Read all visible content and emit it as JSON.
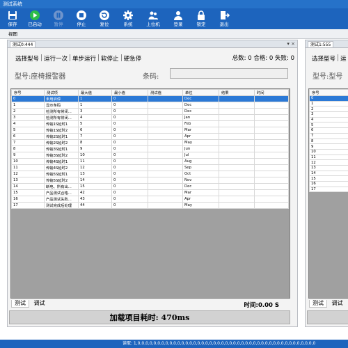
{
  "window": {
    "title": "测试系统"
  },
  "toolbar": [
    {
      "label": "保存",
      "icon": "save-icon",
      "enabled": true
    },
    {
      "label": "已启动",
      "icon": "play-icon",
      "enabled": true
    },
    {
      "label": "暂停",
      "icon": "pause-icon",
      "enabled": false
    },
    {
      "label": "停止",
      "icon": "stop-icon",
      "enabled": true
    },
    {
      "label": "复位",
      "icon": "reset-icon",
      "enabled": true
    },
    {
      "label": "系统",
      "icon": "gear-icon",
      "enabled": true
    },
    {
      "label": "上位机",
      "icon": "users-icon",
      "enabled": true
    },
    {
      "label": "登录",
      "icon": "login-icon",
      "enabled": true
    },
    {
      "label": "锁定",
      "icon": "lock-icon",
      "enabled": true
    },
    {
      "label": "退出",
      "icon": "exit-icon",
      "enabled": true
    }
  ],
  "viewbar": {
    "label": "视图"
  },
  "colors": {
    "toolbar": "#1d64bd",
    "selected_row": "#2b79d6",
    "play_green": "#2dbd4a"
  },
  "panel1": {
    "tab": "测试0:444",
    "tab_controls": "▾ ×",
    "menu": [
      "选择型号",
      "运行一次",
      "单步运行",
      "软停止",
      "硬急停"
    ],
    "counts": "总数: 0 合格: 0 失败: 0",
    "model": "型号:座椅报警器",
    "barcode_label": "条码:",
    "barcode_value": "",
    "table": {
      "headers": [
        "序号",
        "测试项",
        "最大值",
        "最小值",
        "测试值",
        "单位",
        "结果",
        "时间"
      ],
      "rows": [
        [
          "0",
          "未用启停",
          "1",
          "0",
          "",
          "Dec",
          "",
          ""
        ],
        [
          "1",
          "显示条码",
          "1",
          "0",
          "",
          "Dec",
          "",
          ""
        ],
        [
          "2",
          "检测所有常闭...",
          "3",
          "0",
          "",
          "Dec",
          "",
          ""
        ],
        [
          "3",
          "检测所有常闭...",
          "4",
          "0",
          "",
          "Jan",
          "",
          ""
        ],
        [
          "4",
          "传输1S延时1",
          "5",
          "0",
          "",
          "Feb",
          "",
          ""
        ],
        [
          "5",
          "传输1S延时2",
          "6",
          "0",
          "",
          "Mar",
          "",
          ""
        ],
        [
          "6",
          "传输2S延时1",
          "7",
          "0",
          "",
          "Apr",
          "",
          ""
        ],
        [
          "7",
          "传输2S延时2",
          "8",
          "0",
          "",
          "May",
          "",
          ""
        ],
        [
          "8",
          "传输3S延时1",
          "9",
          "0",
          "",
          "Jun",
          "",
          ""
        ],
        [
          "9",
          "传输3S延时2",
          "10",
          "0",
          "",
          "Jul",
          "",
          ""
        ],
        [
          "10",
          "传输4S延时1",
          "11",
          "0",
          "",
          "Aug",
          "",
          ""
        ],
        [
          "11",
          "传输4S延时2",
          "12",
          "0",
          "",
          "Sep",
          "",
          ""
        ],
        [
          "12",
          "传输5S延时1",
          "13",
          "0",
          "",
          "Oct",
          "",
          ""
        ],
        [
          "13",
          "传输5S延时2",
          "14",
          "0",
          "",
          "Nov",
          "",
          ""
        ],
        [
          "14",
          "断电、所有出...",
          "15",
          "0",
          "",
          "Dec",
          "",
          ""
        ],
        [
          "15",
          "产品测试合格...",
          "42",
          "0",
          "",
          "Mar",
          "",
          ""
        ],
        [
          "16",
          "产品测试失败...",
          "43",
          "0",
          "",
          "Apr",
          "",
          ""
        ],
        [
          "17",
          "测试完成后处理",
          "44",
          "0",
          "",
          "May",
          "",
          ""
        ]
      ]
    },
    "bottom_tabs": [
      "测试",
      "调试"
    ],
    "elapsed": "时间:0.00 S",
    "status": "加载项目耗时: 470ms"
  },
  "panel2": {
    "tab": "测试1:555",
    "menu": [
      "选择型号",
      "运"
    ],
    "model": "型号:型号",
    "table": {
      "headers": [
        "序号"
      ],
      "rows": [
        [
          "0"
        ],
        [
          "1"
        ],
        [
          "2"
        ],
        [
          "3"
        ],
        [
          "4"
        ],
        [
          "5"
        ],
        [
          "6"
        ],
        [
          "7"
        ],
        [
          "8"
        ],
        [
          "9"
        ],
        [
          "10"
        ],
        [
          "11"
        ],
        [
          "12"
        ],
        [
          "13"
        ],
        [
          "14"
        ],
        [
          "15"
        ],
        [
          "16"
        ],
        [
          "17"
        ]
      ]
    },
    "bottom_tabs": [
      "测试",
      "调试"
    ]
  },
  "bottombar": {
    "text": "读取: 1,0,0,0,0,0,0,0,0,0,0,0,0,0,0,0,0,0,0,0,0,0,0,0,0,0,0,0,0,0,0,0,0,0,0,0,0,0,0,0,0,0,0,0,0,0"
  }
}
